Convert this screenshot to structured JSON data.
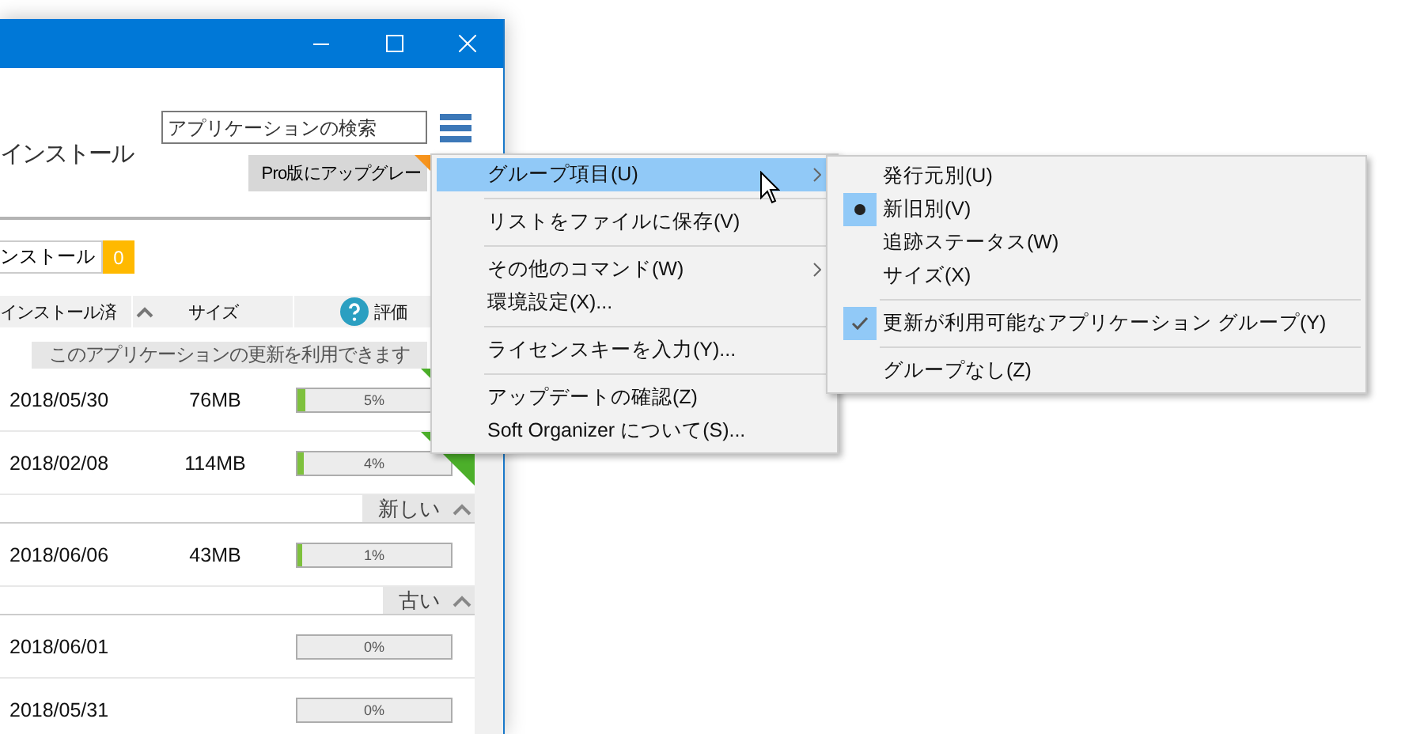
{
  "window": {
    "heading": "インストール"
  },
  "search": {
    "placeholder": "アプリケーションの検索"
  },
  "upgrade_button": {
    "label": "Pro版にアップグレー"
  },
  "tab": {
    "label": "ンストール",
    "count": "0"
  },
  "columns": [
    {
      "label": "インストール済",
      "kind": "sort"
    },
    {
      "label": "サイズ",
      "kind": "plain"
    },
    {
      "label": "評価",
      "kind": "help"
    }
  ],
  "groups": [
    {
      "title": "このアプリケーションの更新を利用できます",
      "kind": "notice",
      "rows": [
        {
          "date": "2018/05/30",
          "size": "76MB",
          "rating": "5%",
          "level": 0.05,
          "flagged": true
        },
        {
          "date": "2018/02/08",
          "size": "114MB",
          "rating": "4%",
          "level": 0.04,
          "flagged": true
        }
      ]
    },
    {
      "title": "新しい",
      "kind": "section",
      "rows": [
        {
          "date": "2018/06/06",
          "size": "43MB",
          "rating": "1%",
          "level": 0.01,
          "flagged": false
        }
      ]
    },
    {
      "title": "古い",
      "kind": "section",
      "rows": [
        {
          "date": "2018/06/01",
          "size": "",
          "rating": "0%",
          "flagged": false
        },
        {
          "date": "2018/05/31",
          "size": "",
          "rating": "0%",
          "flagged": false
        }
      ]
    }
  ],
  "menu": [
    {
      "kind": "item",
      "label": "グループ項目(U)",
      "highlighted": true,
      "submenu": true
    },
    {
      "kind": "separator"
    },
    {
      "kind": "item",
      "label": "リストをファイルに保存(V)",
      "highlighted": false,
      "submenu": false
    },
    {
      "kind": "separator"
    },
    {
      "kind": "item",
      "label": "その他のコマンド(W)",
      "highlighted": false,
      "submenu": true
    },
    {
      "kind": "item",
      "label": "環境設定(X)...",
      "highlighted": false,
      "submenu": false
    },
    {
      "kind": "separator"
    },
    {
      "kind": "item",
      "label": "ライセンスキーを入力(Y)...",
      "highlighted": false,
      "submenu": false
    },
    {
      "kind": "separator"
    },
    {
      "kind": "item",
      "label": "アップデートの確認(Z)",
      "highlighted": false,
      "submenu": false
    },
    {
      "kind": "item",
      "label": "Soft Organizer について(S)...",
      "highlighted": false,
      "submenu": false
    }
  ],
  "submenu": [
    {
      "kind": "radio",
      "label": "発行元別(U)",
      "selected": false
    },
    {
      "kind": "radio",
      "label": "新旧別(V)",
      "selected": true
    },
    {
      "kind": "radio",
      "label": "追跡ステータス(W)",
      "selected": false
    },
    {
      "kind": "radio",
      "label": "サイズ(X)",
      "selected": false
    },
    {
      "kind": "separator"
    },
    {
      "kind": "check",
      "label": "更新が利用可能なアプリケーション グループ(Y)",
      "checked": true
    },
    {
      "kind": "separator"
    },
    {
      "kind": "radio",
      "label": "グループなし(Z)",
      "selected": false
    }
  ]
}
